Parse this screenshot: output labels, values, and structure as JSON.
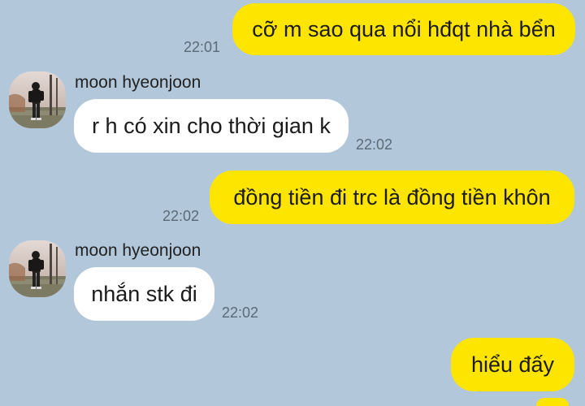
{
  "theme": {
    "background": "#b2c7da",
    "outgoing_bubble": "#fee500",
    "incoming_bubble": "#ffffff",
    "timestamp_color": "#5a6a77"
  },
  "messages": [
    {
      "direction": "out",
      "text": "cỡ m sao qua nổi hđqt nhà bển",
      "time": "22:01"
    },
    {
      "direction": "in",
      "sender": "moon hyeonjoon",
      "text": "r h có xin cho thời gian k",
      "time": "22:02"
    },
    {
      "direction": "out",
      "text": "đồng tiền đi trc là đồng tiền khôn",
      "time": "22:02"
    },
    {
      "direction": "in",
      "sender": "moon hyeonjoon",
      "text": "nhắn stk đi",
      "time": "22:02"
    },
    {
      "direction": "out",
      "text": "hiểu đấy",
      "time": ""
    }
  ],
  "avatar_icon": "profile-photo-person-standing"
}
